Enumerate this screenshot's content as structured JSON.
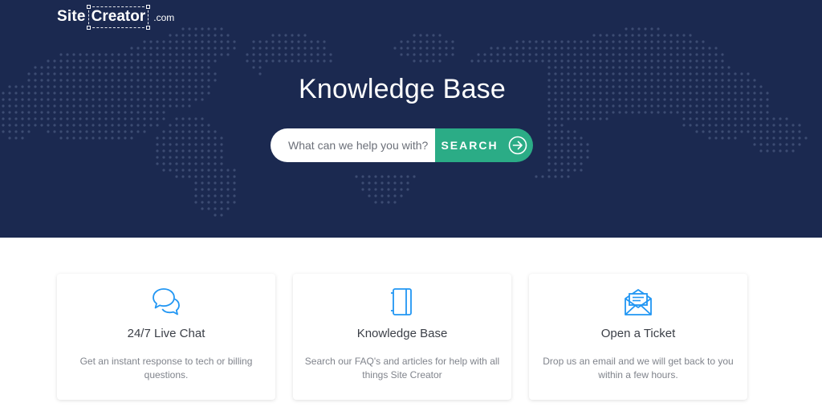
{
  "brand": {
    "site": "Site",
    "creator": "Creator",
    "suffix": ".com"
  },
  "hero": {
    "title": "Knowledge Base",
    "background_color": "#1b2950",
    "dot_color": "#3c4c72"
  },
  "search": {
    "placeholder": "What can we help you with?",
    "button_label": "SEARCH",
    "button_color": "#2bac86",
    "icon": "circle-arrow-right-icon"
  },
  "cards": [
    {
      "icon": "chat-bubbles-icon",
      "title": "24/7 Live Chat",
      "description": "Get an instant response to tech or billing questions."
    },
    {
      "icon": "notebook-icon",
      "title": "Knowledge Base",
      "description": "Search our FAQ's and articles for help with all things Site Creator"
    },
    {
      "icon": "envelope-letter-icon",
      "title": "Open a Ticket",
      "description": "Drop us an email and we will get back to you within a few hours."
    }
  ],
  "colors": {
    "accent": "#2bac86",
    "icon": "#2196f3"
  }
}
